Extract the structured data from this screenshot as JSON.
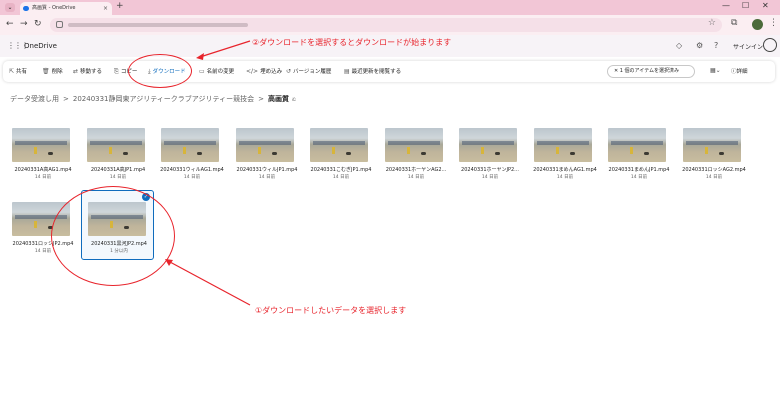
{
  "browser": {
    "tab_title": "高画質 - OneDrive",
    "new_tab": "+",
    "tab_close": "×",
    "win_min": "—",
    "win_max": "☐",
    "win_close": "✕",
    "back": "←",
    "forward": "→",
    "reload": "↻",
    "star": "☆"
  },
  "app": {
    "name": "OneDrive",
    "signin": "サインイン"
  },
  "annotations": {
    "step2": "②ダウンロードを選択するとダウンロードが始まります",
    "step1": "①ダウンロードしたいデータを選択します",
    "color": "#e8242c"
  },
  "commandbar": {
    "share": "共有",
    "delete": "削除",
    "move": "移動する",
    "copy": "コピー",
    "download": "ダウンロード",
    "rename": "名前の変更",
    "embed": "埋め込み",
    "version_history": "バージョン履歴",
    "latest_news": "最近更新を閲覧する",
    "selection": "1 個のアイテムを選択済み",
    "details": "詳細"
  },
  "breadcrumb": {
    "root": "データ受渡し用",
    "parent": "20240331静岡東アジリティークラブアジリティー競技会",
    "current": "高画質",
    "separator": ">",
    "share_icon": "ಏ"
  },
  "files": [
    {
      "name": "20240331A高AG1.mp4",
      "date": "14 日前"
    },
    {
      "name": "20240331A高JP1.mp4",
      "date": "14 日前"
    },
    {
      "name": "20240331ウィルAG1.mp4",
      "date": "14 日前"
    },
    {
      "name": "20240331ウィルJP1.mp4",
      "date": "14 日前"
    },
    {
      "name": "20240331こむぎJP1.mp4",
      "date": "14 日前"
    },
    {
      "name": "20240331ホーヤンAG2...",
      "date": "14 日前"
    },
    {
      "name": "20240331ホーヤンJP2...",
      "date": "14 日前"
    },
    {
      "name": "20240331まめんAG1.mp4",
      "date": "14 日前"
    },
    {
      "name": "20240331まめんJP1.mp4",
      "date": "14 日前"
    },
    {
      "name": "20240331ロッシAG2.mp4",
      "date": "14 日前"
    },
    {
      "name": "20240331ロッシJP2.mp4",
      "date": "14 日前"
    },
    {
      "name": "20240331黒河JP2.mp4",
      "date": "1 分以内",
      "selected": true
    }
  ],
  "colors": {
    "accent": "#0f6cbd",
    "annotation": "#e8242c"
  }
}
